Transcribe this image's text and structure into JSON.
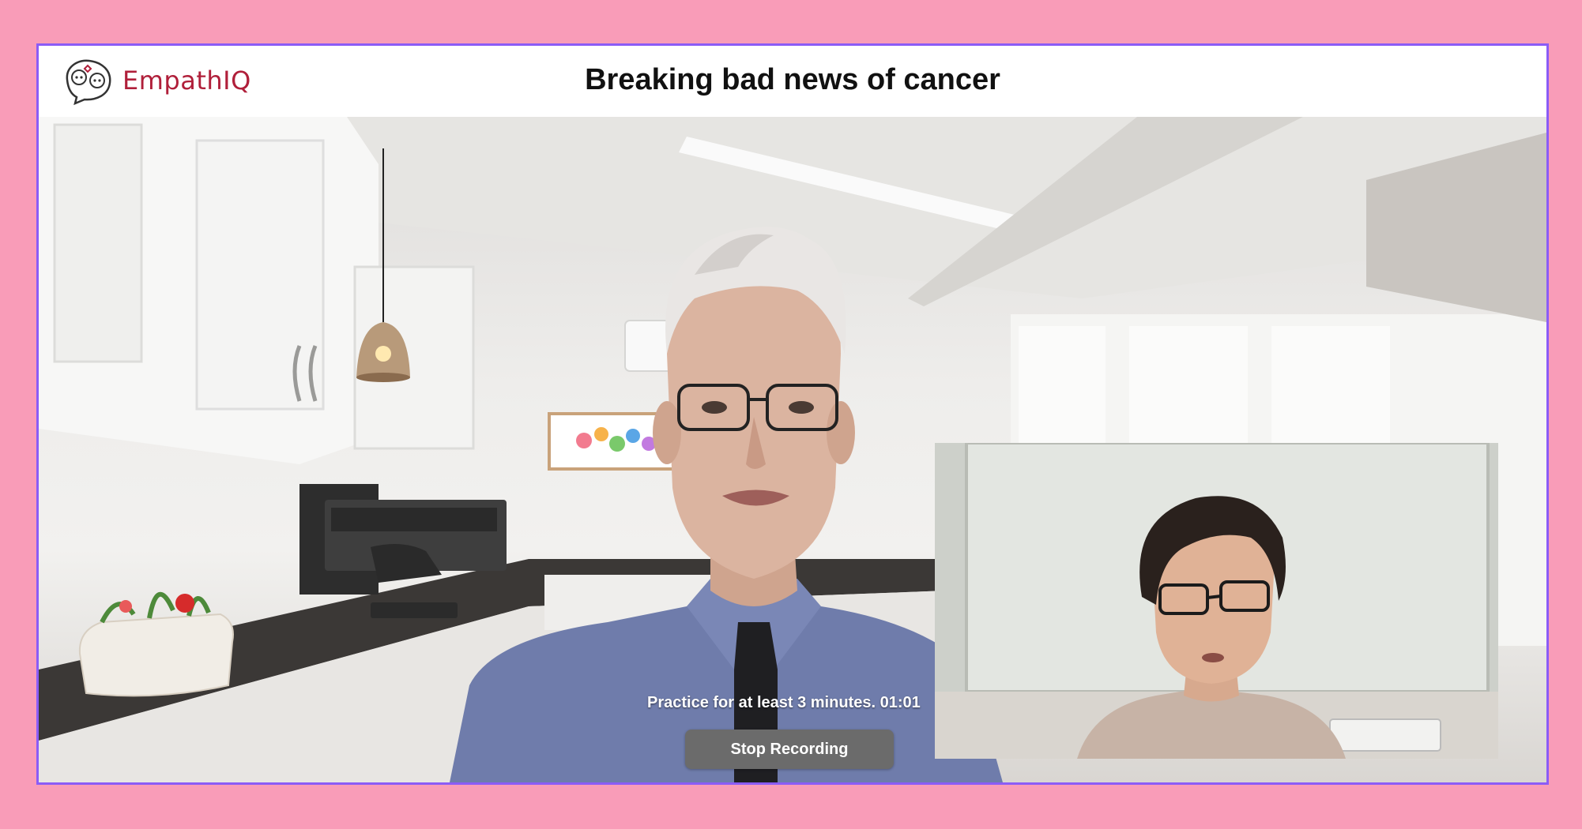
{
  "app": {
    "logo_text": "EmpathIQ",
    "logo_icon": "two-faces-speech-bubble-icon",
    "title": "Breaking bad news of cancer"
  },
  "session": {
    "practice_message": "Practice for at least 3 minutes.",
    "timer": "01:01",
    "stop_button_label": "Stop Recording"
  },
  "colors": {
    "page_background": "#f99cb8",
    "frame_border": "#8b5cf6",
    "brand_red": "#b01f3a",
    "button_background": "#6b6b6b"
  }
}
